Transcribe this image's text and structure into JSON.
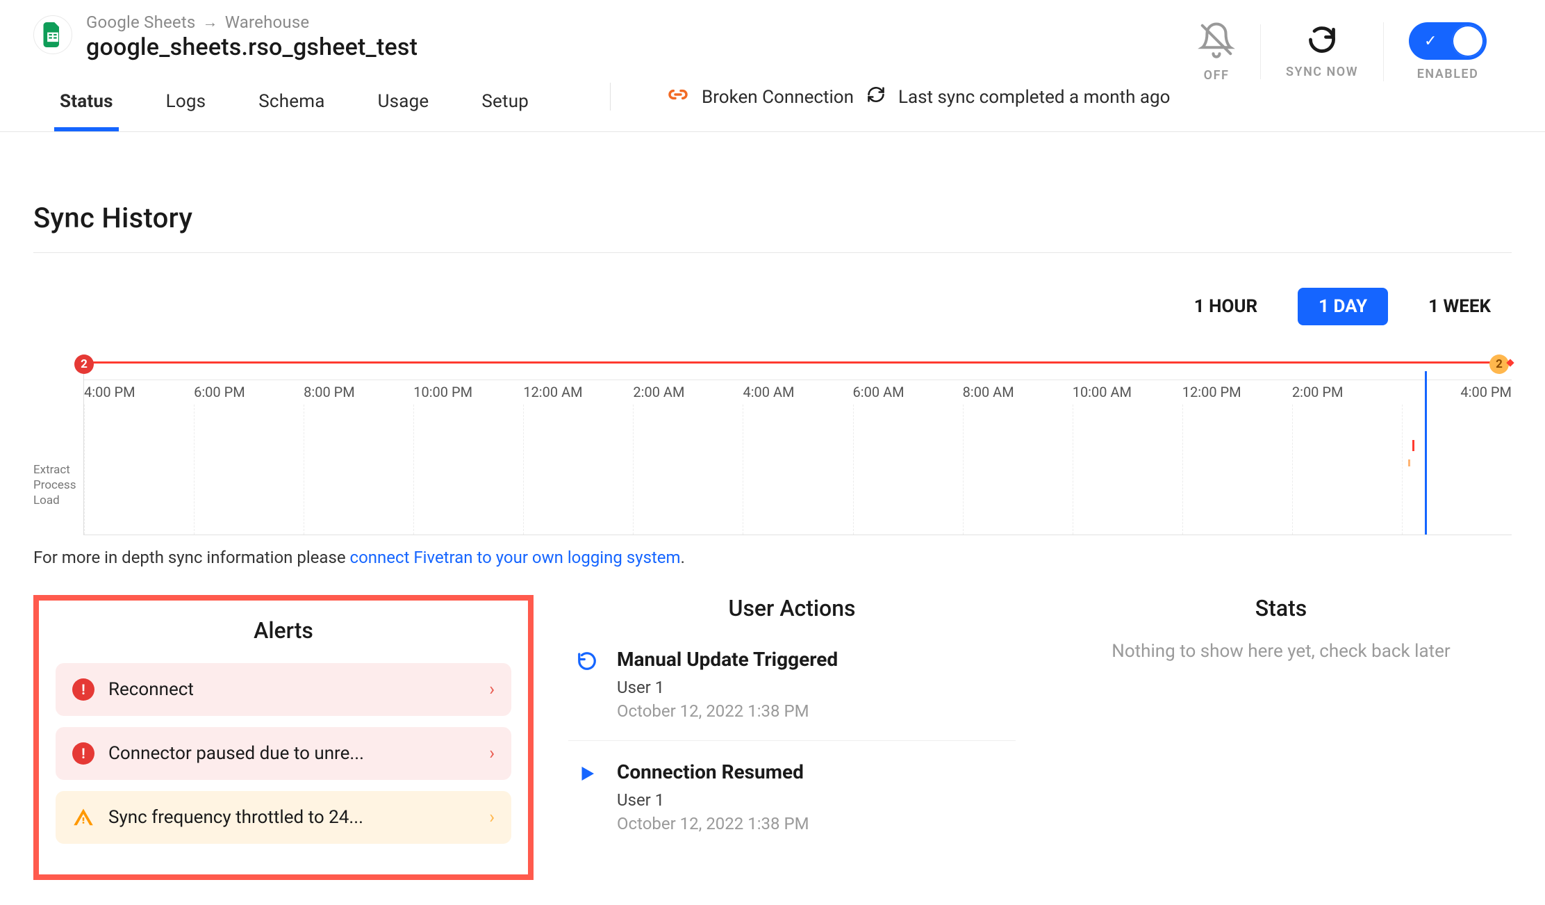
{
  "header": {
    "breadcrumb_source": "Google Sheets",
    "breadcrumb_dest": "Warehouse",
    "title": "google_sheets.rso_gsheet_test",
    "tabs": [
      "Status",
      "Logs",
      "Schema",
      "Usage",
      "Setup"
    ],
    "active_tab": "Status",
    "status_broken": "Broken Connection",
    "status_last_sync": "Last sync completed a month ago",
    "notif_label": "OFF",
    "sync_now_label": "SYNC NOW",
    "enabled_label": "ENABLED"
  },
  "sync_history": {
    "title": "Sync History",
    "ranges": [
      "1 HOUR",
      "1 DAY",
      "1 WEEK"
    ],
    "active_range": "1 DAY",
    "footnote_prefix": "For more in depth sync information please ",
    "footnote_link": "connect Fivetran to your own logging system",
    "footnote_suffix": "."
  },
  "chart_data": {
    "type": "timeline",
    "x_ticks": [
      "4:00 PM",
      "6:00 PM",
      "8:00 PM",
      "10:00 PM",
      "12:00 AM",
      "2:00 AM",
      "4:00 AM",
      "6:00 AM",
      "8:00 AM",
      "10:00 AM",
      "12:00 PM",
      "2:00 PM",
      "4:00 PM"
    ],
    "y_labels": [
      "Extract",
      "Process",
      "Load"
    ],
    "error_span": {
      "start_tick": 0,
      "end_tick": 12
    },
    "badges": [
      {
        "position": "start",
        "value": "2",
        "color": "#e53935"
      },
      {
        "position": "end",
        "value": "2",
        "color": "#ffb74d"
      }
    ],
    "markers": [
      {
        "type": "vertical_line_blue",
        "approx_tick": 11.9
      },
      {
        "type": "red_tick",
        "approx_tick": 11.8,
        "row": "Extract"
      },
      {
        "type": "orange_tick",
        "approx_tick": 11.8,
        "row": "Process"
      }
    ]
  },
  "alerts": {
    "title": "Alerts",
    "items": [
      {
        "level": "error",
        "text": "Reconnect"
      },
      {
        "level": "error",
        "text": "Connector paused due to unre..."
      },
      {
        "level": "warn",
        "text": "Sync frequency throttled to 24..."
      }
    ]
  },
  "user_actions": {
    "title": "User Actions",
    "items": [
      {
        "icon": "refresh",
        "title": "Manual Update Triggered",
        "user": "User 1",
        "time": "October 12, 2022 1:38 PM"
      },
      {
        "icon": "play",
        "title": "Connection Resumed",
        "user": "User 1",
        "time": "October 12, 2022 1:38 PM"
      }
    ]
  },
  "stats": {
    "title": "Stats",
    "empty": "Nothing to show here yet, check back later"
  }
}
